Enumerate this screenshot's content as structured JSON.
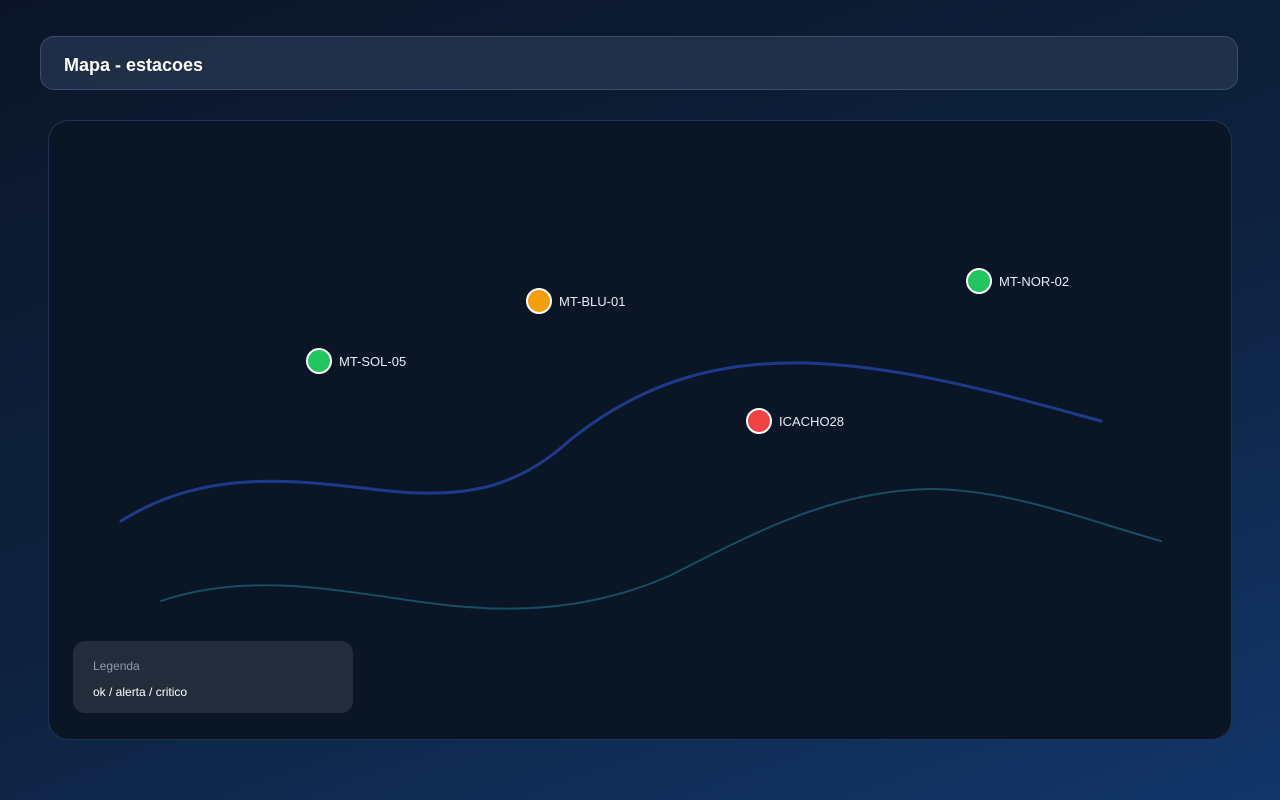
{
  "header": {
    "title": "Mapa - estacoes"
  },
  "map": {
    "stations": [
      {
        "id": "MT-SOL-05",
        "label": "MT-SOL-05",
        "status": "ok"
      },
      {
        "id": "MT-BLU-01",
        "label": "MT-BLU-01",
        "status": "alerta"
      },
      {
        "id": "ICACHO28",
        "label": "ICACHO28",
        "status": "critico"
      },
      {
        "id": "MT-NOR-02",
        "label": "MT-NOR-02",
        "status": "ok"
      }
    ],
    "status_colors": {
      "ok": "#22c55e",
      "alerta": "#f59e0b",
      "critico": "#ef4444"
    },
    "river_colors": {
      "main": "#1e3a8a",
      "secondary": "#164e63"
    }
  },
  "legend": {
    "title": "Legenda",
    "items": "ok / alerta / critico"
  }
}
